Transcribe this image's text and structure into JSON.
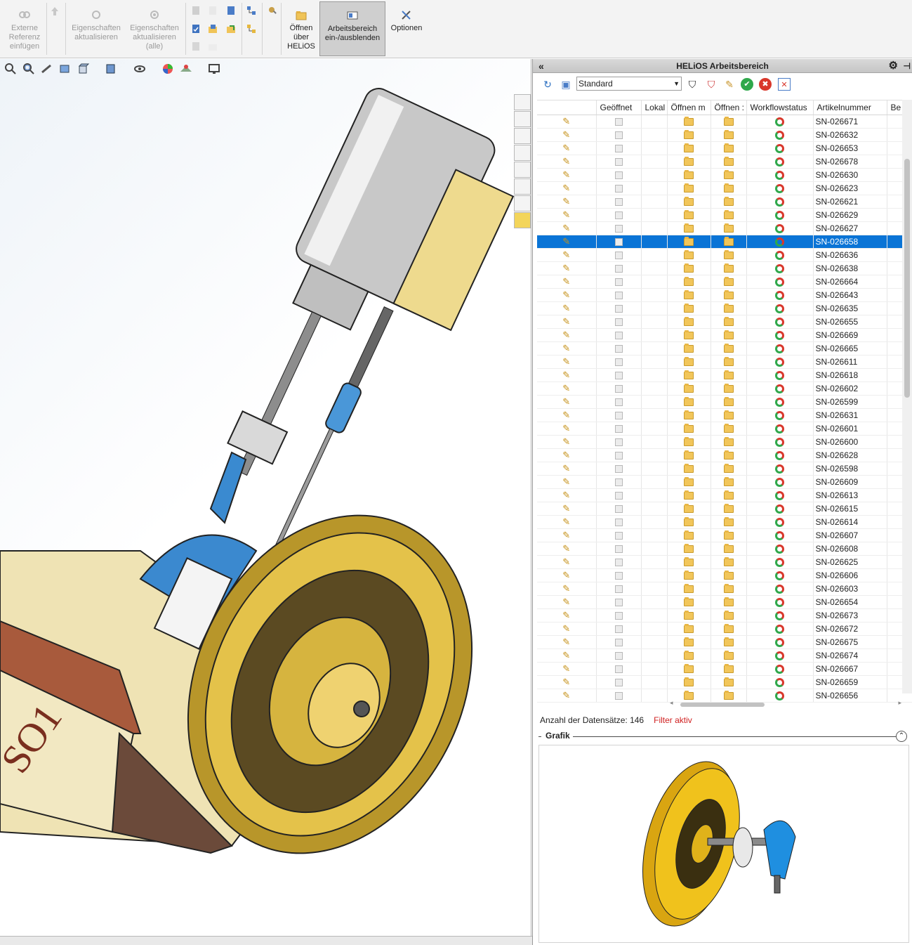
{
  "ribbon": {
    "buttons": [
      {
        "label": "Externe Referenz einfügen",
        "disabled": true
      },
      {
        "label": "Eigenschaften aktualisieren",
        "disabled": true
      },
      {
        "label": "Eigenschaften aktualisieren (alle)",
        "disabled": true
      },
      {
        "label": "Öffnen über HELiOS",
        "disabled": false
      },
      {
        "label": "Arbeitsbereich ein-/ausblenden",
        "disabled": false,
        "active": true
      },
      {
        "label": "Optionen",
        "disabled": false
      }
    ]
  },
  "panel": {
    "title": "HELiOS Arbeitsbereich",
    "view_select": "Standard",
    "columns": [
      "",
      "Geöffnet",
      "Lokal",
      "Öffnen m",
      "Öffnen :",
      "Workflowstatus",
      "Artikelnummer",
      "Be"
    ],
    "rows": [
      "SN-026671",
      "SN-026632",
      "SN-026653",
      "SN-026678",
      "SN-026630",
      "SN-026623",
      "SN-026621",
      "SN-026629",
      "SN-026627",
      "SN-026658",
      "SN-026636",
      "SN-026638",
      "SN-026664",
      "SN-026643",
      "SN-026635",
      "SN-026655",
      "SN-026669",
      "SN-026665",
      "SN-026611",
      "SN-026618",
      "SN-026602",
      "SN-026599",
      "SN-026631",
      "SN-026601",
      "SN-026600",
      "SN-026628",
      "SN-026598",
      "SN-026609",
      "SN-026613",
      "SN-026615",
      "SN-026614",
      "SN-026607",
      "SN-026608",
      "SN-026625",
      "SN-026606",
      "SN-026603",
      "SN-026654",
      "SN-026673",
      "SN-026672",
      "SN-026675",
      "SN-026674",
      "SN-026667",
      "SN-026659",
      "SN-026656"
    ],
    "selected_row": "SN-026658",
    "status": {
      "count_label": "Anzahl der Datensätze: 146",
      "filter_label": "Filter aktiv"
    },
    "grafik_label": "Grafik"
  },
  "colors": {
    "selection": "#0a74d6",
    "filter": "#d02020",
    "brass": "#e2b81d"
  }
}
